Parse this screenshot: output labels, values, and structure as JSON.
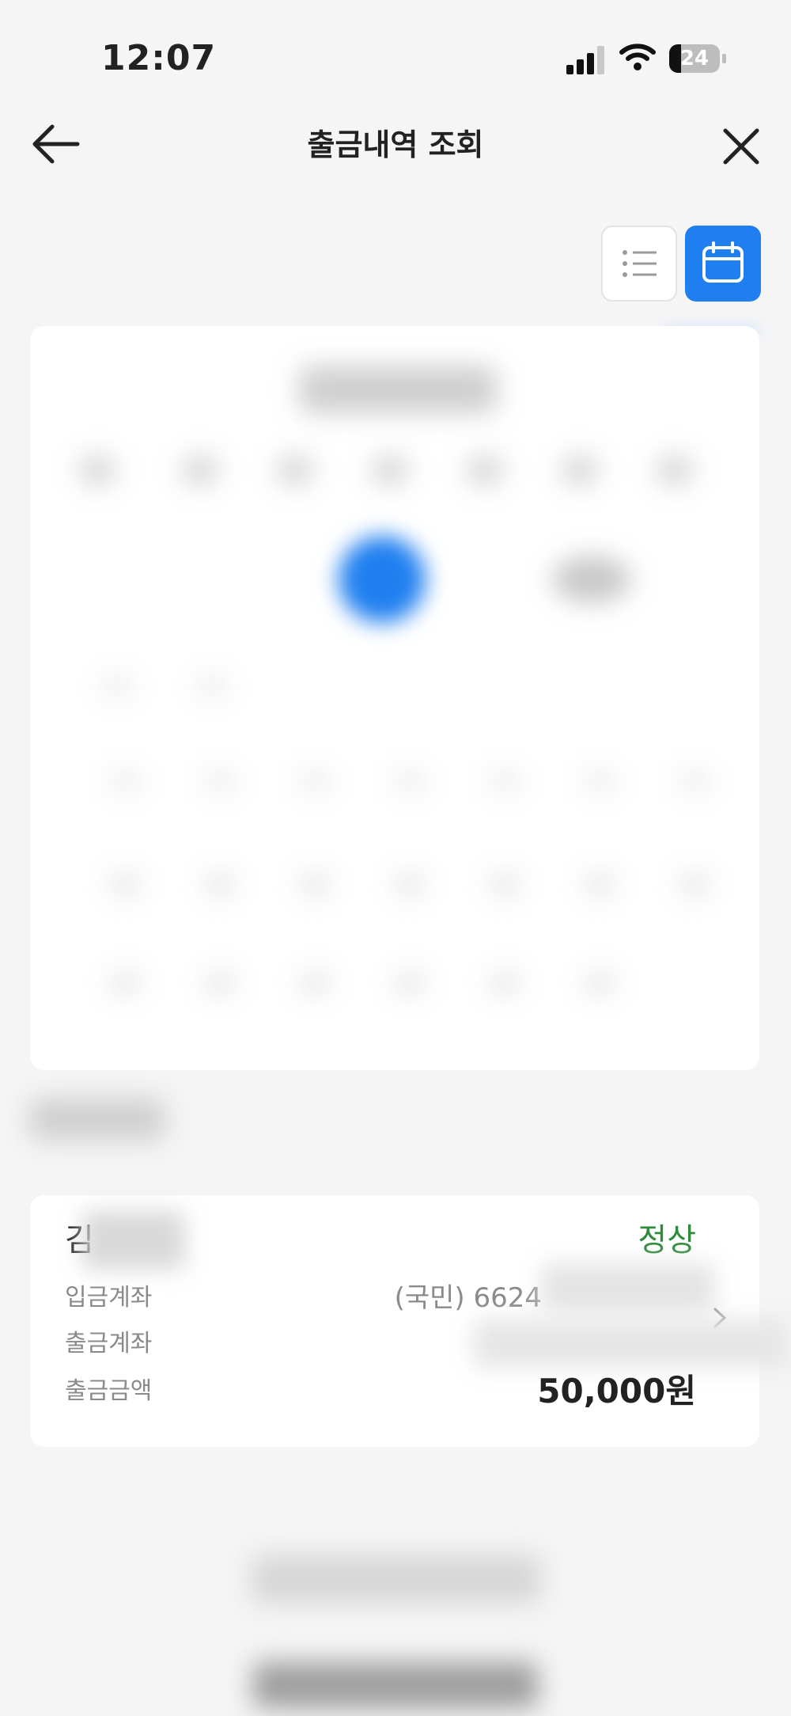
{
  "status_bar": {
    "time": "12:07",
    "battery": "24"
  },
  "header": {
    "title": "출금내역 조회"
  },
  "view_toggle": {
    "list_icon": "list-icon",
    "calendar_icon": "calendar-icon",
    "active": "calendar"
  },
  "transaction": {
    "name_visible": "김",
    "status": "정상",
    "deposit_account_label": "입금계좌",
    "deposit_account_value": "(국민) 6624",
    "withdraw_account_label": "출금계좌",
    "amount_label": "출금금액",
    "amount_value": "50,000원"
  },
  "colors": {
    "accent": "#1f7ff0",
    "status_green": "#2e8b3b"
  }
}
